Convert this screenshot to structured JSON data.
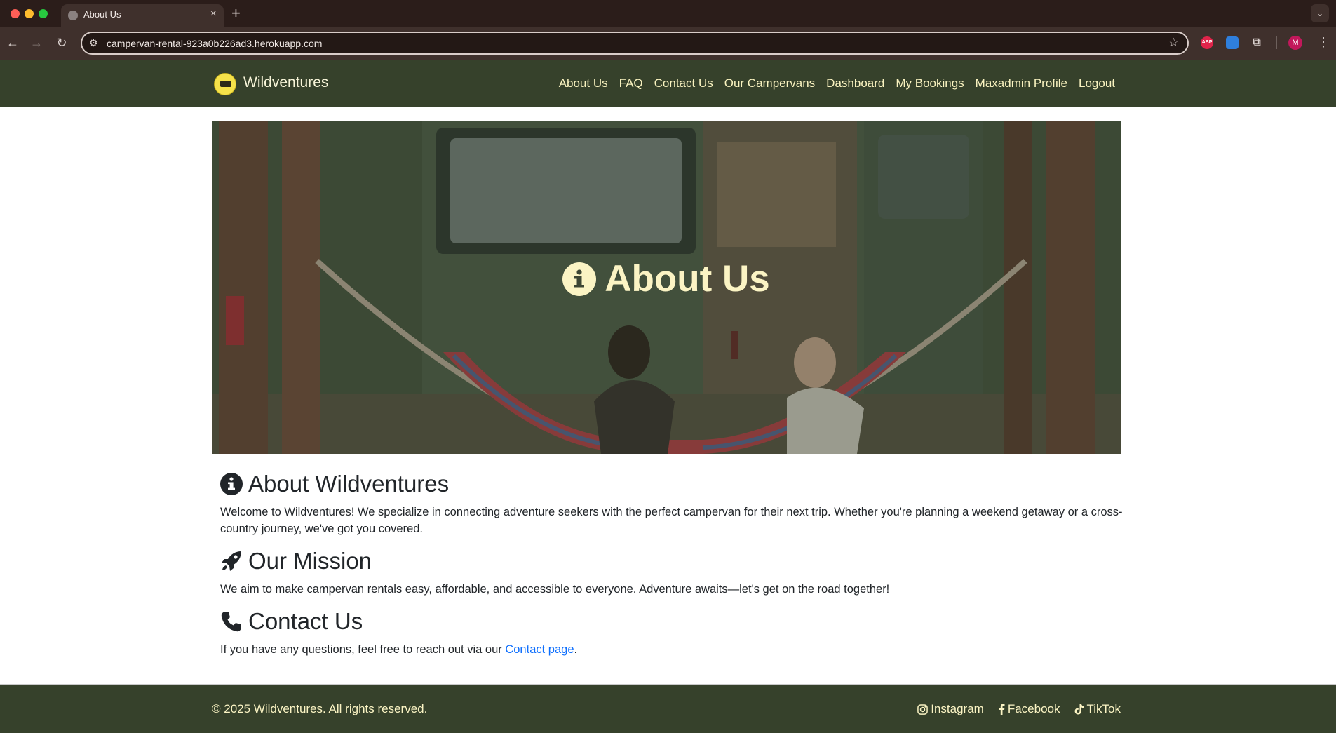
{
  "browser": {
    "tab_title": "About Us",
    "url": "campervan-rental-923a0b226ad3.herokuapp.com",
    "profile_initial": "M",
    "abp_label": "ABP"
  },
  "nav": {
    "brand": "Wildventures",
    "links": [
      "About Us",
      "FAQ",
      "Contact Us",
      "Our Campervans",
      "Dashboard",
      "My Bookings",
      "Maxadmin Profile",
      "Logout"
    ]
  },
  "hero": {
    "title": "About Us",
    "icon": "info-circle-icon"
  },
  "sections": {
    "about": {
      "heading": "About Wildventures",
      "icon": "info-circle-icon",
      "text": "Welcome to Wildventures! We specialize in connecting adventure seekers with the perfect campervan for their next trip. Whether you're planning a weekend getaway or a cross-country journey, we've got you covered."
    },
    "mission": {
      "heading": "Our Mission",
      "icon": "rocket-icon",
      "text": "We aim to make campervan rentals easy, affordable, and accessible to everyone. Adventure awaits—let's get on the road together!"
    },
    "contact": {
      "heading": "Contact Us",
      "icon": "phone-icon",
      "text_before": "If you have any questions, feel free to reach out via our ",
      "link_text": "Contact page",
      "text_after": "."
    }
  },
  "footer": {
    "copyright": "© 2025 Wildventures. All rights reserved.",
    "social": [
      "Instagram",
      "Facebook",
      "TikTok"
    ]
  },
  "colors": {
    "navbar_bg": "#36412b",
    "nav_text": "#faf3c0",
    "link_blue": "#0d6efd"
  }
}
